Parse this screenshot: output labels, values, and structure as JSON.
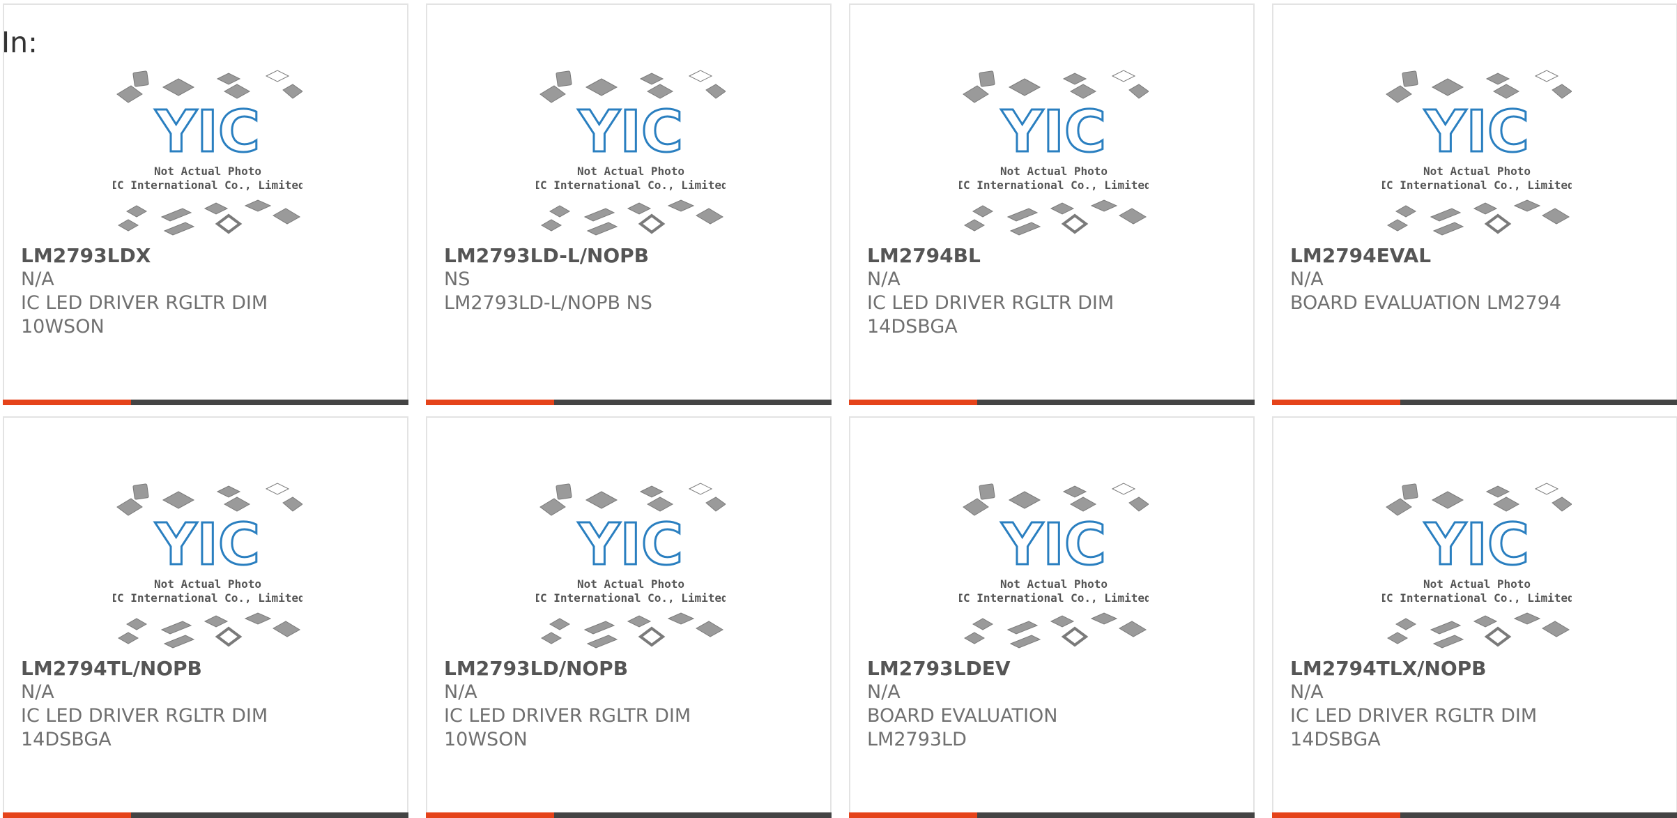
{
  "header": {
    "in_label": "In:"
  },
  "placeholder": {
    "logo_text": "YIC",
    "line1": "Not Actual Photo",
    "line2": "YIC International Co., Limited."
  },
  "colors": {
    "accent": "#e5431a",
    "bar": "#444444",
    "logo": "#2a7fc0"
  },
  "products": [
    {
      "part_no": "LM2793LDX",
      "manufacturer": "N/A",
      "description": "IC LED DRIVER RGLTR DIM 10WSON"
    },
    {
      "part_no": "LM2793LD-L/NOPB",
      "manufacturer": "NS",
      "description": "LM2793LD-L/NOPB NS"
    },
    {
      "part_no": "LM2794BL",
      "manufacturer": "N/A",
      "description": "IC LED DRIVER RGLTR DIM 14DSBGA"
    },
    {
      "part_no": "LM2794EVAL",
      "manufacturer": "N/A",
      "description": "BOARD EVALUATION LM2794"
    },
    {
      "part_no": "LM2794TL/NOPB",
      "manufacturer": "N/A",
      "description": "IC LED DRIVER RGLTR DIM 14DSBGA"
    },
    {
      "part_no": "LM2793LD/NOPB",
      "manufacturer": "N/A",
      "description": "IC LED DRIVER RGLTR DIM 10WSON"
    },
    {
      "part_no": "LM2793LDEV",
      "manufacturer": "N/A",
      "description": "BOARD EVALUATION LM2793LD"
    },
    {
      "part_no": "LM2794TLX/NOPB",
      "manufacturer": "N/A",
      "description": "IC LED DRIVER RGLTR DIM 14DSBGA"
    }
  ]
}
